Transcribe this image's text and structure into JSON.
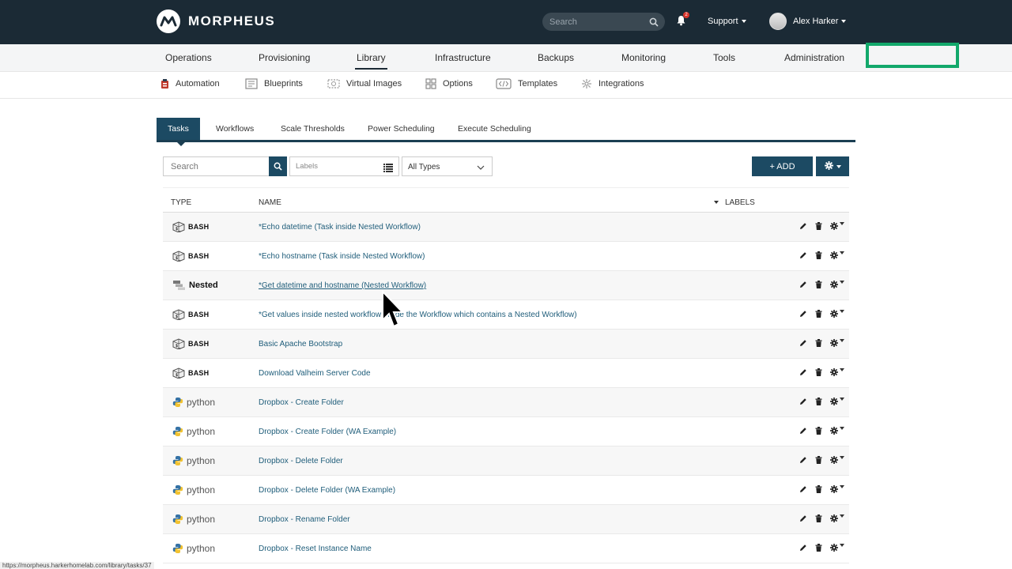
{
  "header": {
    "brand": "MORPHEUS",
    "search_placeholder": "Search",
    "notification_count": "2",
    "support_label": "Support",
    "user_name": "Alex Harker"
  },
  "main_nav": [
    "Operations",
    "Provisioning",
    "Library",
    "Infrastructure",
    "Backups",
    "Monitoring",
    "Tools",
    "Administration"
  ],
  "main_nav_active": "Library",
  "sub_nav": [
    "Automation",
    "Blueprints",
    "Virtual Images",
    "Options",
    "Templates",
    "Integrations"
  ],
  "tabs": [
    "Tasks",
    "Workflows",
    "Scale Thresholds",
    "Power Scheduling",
    "Execute Scheduling"
  ],
  "filters": {
    "search_placeholder": "Search",
    "labels_placeholder": "Labels",
    "type_selected": "All Types"
  },
  "actions": {
    "add_label": "+ ADD"
  },
  "table": {
    "columns": {
      "type": "TYPE",
      "name": "NAME",
      "labels": "LABELS"
    },
    "rows": [
      {
        "type": "BASH",
        "name": "*Echo datetime (Task inside Nested Workflow)"
      },
      {
        "type": "BASH",
        "name": "*Echo hostname (Task inside Nested Workflow)"
      },
      {
        "type": "Nested",
        "name": "*Get datetime and hostname (Nested Workflow)"
      },
      {
        "type": "BASH",
        "name": "*Get values inside nested workflow inside the Workflow which contains a Nested Workflow)"
      },
      {
        "type": "BASH",
        "name": "Basic Apache Bootstrap"
      },
      {
        "type": "BASH",
        "name": "Download Valheim Server Code"
      },
      {
        "type": "python",
        "name": "Dropbox - Create Folder"
      },
      {
        "type": "python",
        "name": "Dropbox - Create Folder (WA Example)"
      },
      {
        "type": "python",
        "name": "Dropbox - Delete Folder"
      },
      {
        "type": "python",
        "name": "Dropbox - Delete Folder (WA Example)"
      },
      {
        "type": "python",
        "name": "Dropbox - Rename Folder"
      },
      {
        "type": "python",
        "name": "Dropbox - Reset Instance Name"
      }
    ]
  },
  "status_url": "https://morpheus.harkerhomelab.com/library/tasks/37",
  "colors": {
    "header_bg": "#1b2a35",
    "primary": "#1c4a63",
    "link": "#1f5d7a",
    "highlight": "#12a86b"
  }
}
